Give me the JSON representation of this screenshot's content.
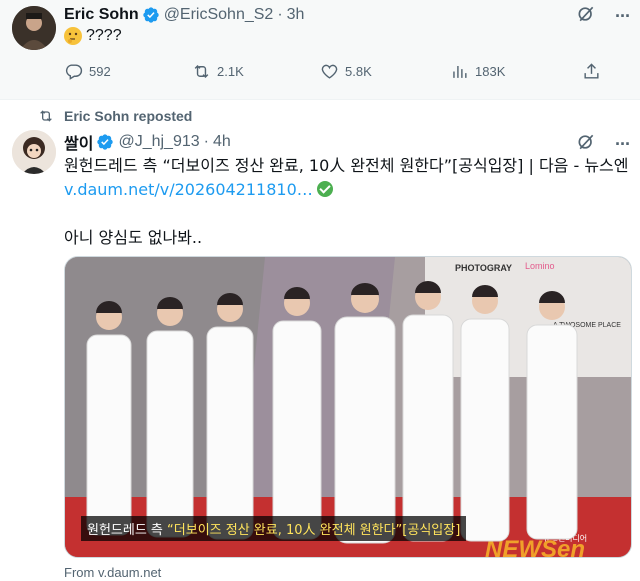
{
  "post1": {
    "author_name": "Eric Sohn",
    "handle": "@EricSohn_S2",
    "separator": "·",
    "time": "3h",
    "text": "????",
    "emoji": "thinking-face",
    "actions": {
      "replies": "592",
      "reposts": "2.1K",
      "likes": "5.8K",
      "views": "183K"
    }
  },
  "repost_banner": "Eric Sohn reposted",
  "post2": {
    "author_name": "쌀이",
    "handle": "@J_hj_913",
    "separator": "·",
    "time": "4h",
    "text_line1": "원헌드레드 측 “더보이즈 정산 완료, 10人 완전체 원한다”[공식입장] | 다음 - 뉴스엔",
    "link_text": "v.daum.net/v/202604211810…",
    "text_para2": "아니 양심도 없나봐..",
    "media": {
      "caption_white": "원헌드레드 측",
      "caption_yellow": "“더보이즈 정산 완료, 10人 완전체 원한다”[공식입장]",
      "backdrop_text_1": "PHOTOGRAY",
      "backdrop_text_2": "Lomino",
      "backdrop_text_3": "A TWOSOME PLACE",
      "backdrop_text_4": "뉴스엔미디어",
      "backdrop_text_5": "NEWSen"
    },
    "source": "From v.daum.net"
  },
  "colors": {
    "accent": "#1d9bf0",
    "muted": "#536471",
    "verified": "#1d9bf0"
  }
}
